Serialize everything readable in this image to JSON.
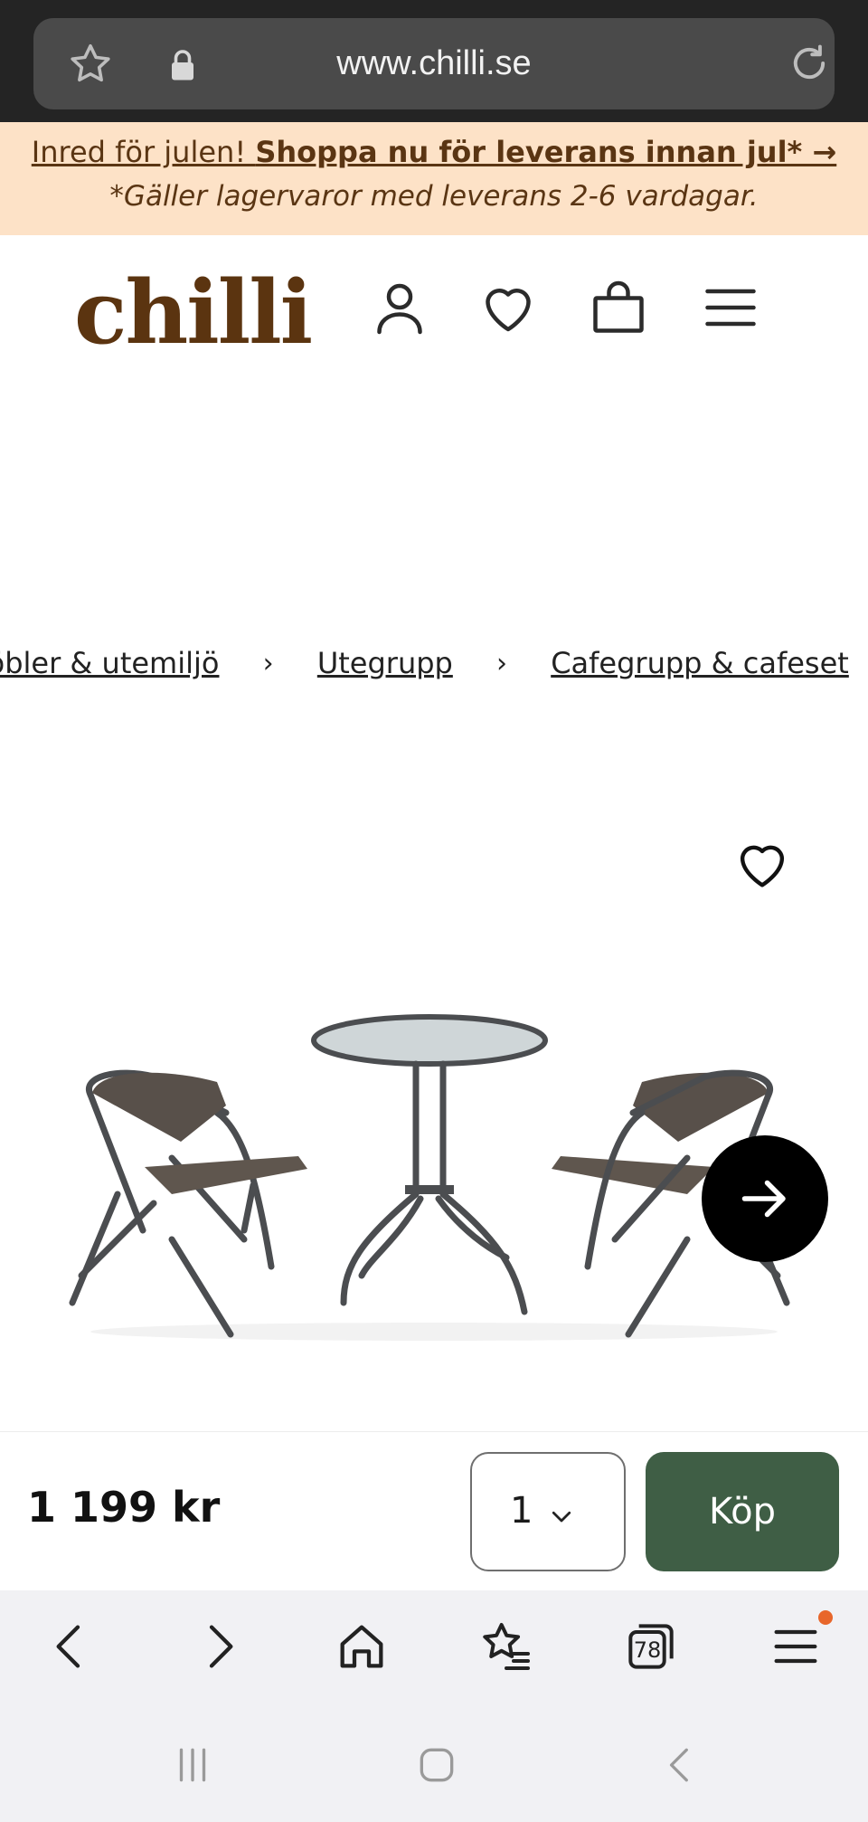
{
  "browser": {
    "url": "www.chilli.se",
    "tabs_count": "78"
  },
  "promo": {
    "line1_prefix": "Inred för julen! ",
    "line1_bold": "Shoppa nu för leverans innan jul* →",
    "line2": "*Gäller lagervaror med leverans 2-6 vardagar."
  },
  "header": {
    "logo": "chilli"
  },
  "breadcrumb": {
    "items": [
      "Möbler & utemiljö",
      "Utegrupp",
      "Cafegrupp & cafeset"
    ],
    "separator": "›"
  },
  "product": {
    "image_alt": "cafe-set-table-two-chairs"
  },
  "buybar": {
    "price": "1 199 kr",
    "quantity": "1",
    "buy_label": "Köp"
  },
  "colors": {
    "brand": "#5b3410",
    "promo_bg": "#fde2c7",
    "buy_button": "#3f5e45",
    "notification": "#e8662a"
  }
}
